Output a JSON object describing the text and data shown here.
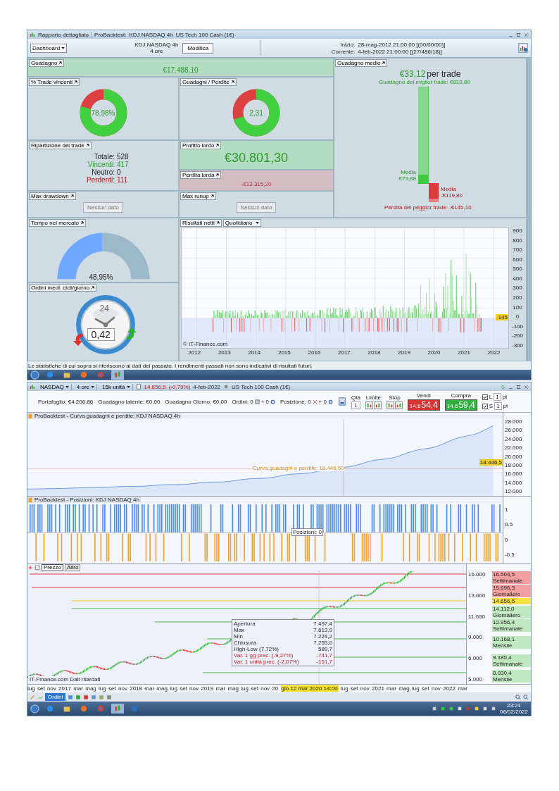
{
  "report_window": {
    "title_bar": {
      "title": "Rapporto dettagliato",
      "tab": "ProBacktest:",
      "system": "KDJ NASDAQ 4h",
      "instrument": "US Tech 100 Cash (1€)"
    },
    "toolbar": {
      "view": "Dashboard",
      "system": "KDJ NASDAQ 4h",
      "timeframe": "4 ore",
      "edit_button": "Modifica",
      "start_label": "Inizio:",
      "start": "28-mag-2012 21:00:00 [(00/00/00)]",
      "current_label": "Corrente:",
      "current": "4-feb-2022 21:00:00 [(27/486/18)]"
    },
    "gain": {
      "title": "Guadagno",
      "value": "€17.488,10"
    },
    "avg_gain": {
      "title": "Guadagno medio",
      "value": "€33,12",
      "unit": "per trade",
      "best_label": "Guadagno del miglior trade: €810,80",
      "win_avg_label": "Media",
      "win_avg": "€73,88",
      "loss_avg_label": "Media",
      "loss_avg": "-€119,80",
      "worst_label": "Perdita del peggior trade: -€145,10"
    },
    "win_rate": {
      "title": "% Trade vincenti",
      "value": "78,98%",
      "level": 0.7898
    },
    "gain_loss": {
      "title": "Guadagni / Perdite",
      "value": "2,31",
      "level": 0.698
    },
    "breakdown": {
      "title": "Ripartizione dei trade",
      "rows": [
        {
          "label": "Totale:",
          "value": "528",
          "kind": "total"
        },
        {
          "label": "Vincenti:",
          "value": "417",
          "kind": "win"
        },
        {
          "label": "Neutro:",
          "value": "0",
          "kind": "neutral"
        },
        {
          "label": "Perdenti:",
          "value": "111",
          "kind": "loss"
        }
      ]
    },
    "gross_profit": {
      "title": "Profitto lordo",
      "value": "€30.801,30"
    },
    "gross_loss": {
      "title": "Perdita lorda",
      "value": "-€13.315,20"
    },
    "max_drawdown": {
      "title": "Max drawdown",
      "empty": "Nessun dato"
    },
    "max_runup": {
      "title": "Max runup",
      "empty": "Nessun dato"
    },
    "time_in_market": {
      "title": "Tempo nel mercato",
      "value": "48,95%"
    },
    "orders_per_day": {
      "title": "Ordini medi. cicli/giorno",
      "hours": "24",
      "value": "0,42"
    },
    "results": {
      "title": "Risultati netti",
      "period": "Quotidiano",
      "credit": "© IT-Finance.com",
      "marker": "-145",
      "yticks": [
        "900",
        "800",
        "700",
        "600",
        "500",
        "400",
        "300",
        "200",
        "100",
        "0",
        "-100",
        "-200",
        "-300"
      ],
      "xlabels": [
        "2012",
        "2013",
        "2014",
        "2015",
        "2016",
        "2017",
        "2018",
        "2019",
        "2020",
        "2021",
        "2022"
      ]
    },
    "disclaimer": "Le statistiche di cui sopra si riferiscono ai dati del passato. I rendimenti passati non sono indicativi di risultati futuri."
  },
  "chart_window": {
    "title_bar": {
      "symbol": "NASDAQ",
      "timeframe": "4 ore",
      "units": "15k unità",
      "price": "14.656,5",
      "change": "(-0,79%)",
      "date": "4-feb-2022",
      "instrument": "US Tech 100 Cash (1€)"
    },
    "trade_bar": {
      "portfolio": "Portafoglio: €4.206,86",
      "latent": "Guadagno latente: €0,00",
      "day": "Guadagno Giorno: €0,00",
      "orders": "Ordini: 0",
      "orders_plus": "+ 0",
      "position": "Posizione: 0",
      "position_plus": "+ 0",
      "qty_label": "Qtà",
      "qty": "1",
      "limit": "Limite",
      "stop": "Stop",
      "sell": {
        "label": "Vendi",
        "prefix": "14.6",
        "price": "54,4"
      },
      "buy": {
        "label": "Compra",
        "prefix": "14.6",
        "price": "59,4"
      },
      "side_rows": [
        {
          "checked": true,
          "label": "L",
          "value": "1",
          "unit": "pt"
        },
        {
          "checked": true,
          "label": "S",
          "value": "1",
          "unit": "pt"
        }
      ]
    },
    "equity_panel": {
      "title": "ProBacktest - Curva guadagni e perdite: KDJ NASDAQ 4h",
      "annotation": "Curva guadagni e perdite: 18.446,50",
      "marker": "18.446,5",
      "yticks": [
        "28.000",
        "26.000",
        "24.000",
        "22.000",
        "20.000",
        "18.000",
        "16.000",
        "14.000",
        "12.000"
      ]
    },
    "positions_panel": {
      "title": "ProBacktest - Posizioni: KDJ NASDAQ 4h",
      "tooltip": "Posizioni: 0",
      "yticks": [
        "1",
        "0.5",
        "0",
        "-0.5"
      ]
    },
    "price_panel": {
      "tabs": [
        {
          "label": "Prezzo",
          "selected": true
        },
        {
          "label": "Altro",
          "selected": false
        }
      ],
      "yticks": [
        "16.000",
        "13.000",
        "11.000",
        "9.000",
        "6.000",
        "5.000"
      ],
      "levels": [
        {
          "value": "16.504,5",
          "label": "Settimanale",
          "kind": "resistance"
        },
        {
          "value": "15.696,3",
          "label": "Giornaliero",
          "kind": "resistance"
        },
        {
          "value": "14.656,5",
          "kind": "current"
        },
        {
          "value": "14.112,0",
          "label": "Giornaliero",
          "kind": "support"
        },
        {
          "value": "12.956,4",
          "label": "Settimanale",
          "kind": "support"
        },
        {
          "value": "10.168,1",
          "label": "Mensile",
          "kind": "support"
        },
        {
          "value": "9.180,4",
          "label": "Settimanale",
          "kind": "support"
        },
        {
          "value": "8.030,4",
          "label": "Mensile",
          "kind": "support"
        }
      ],
      "tooltip": [
        {
          "label": "Apertura",
          "value": "7.497,4",
          "kind": "plain"
        },
        {
          "label": "Max",
          "value": "7.613,9",
          "kind": "plain"
        },
        {
          "label": "Min",
          "value": "7.224,2",
          "kind": "plain"
        },
        {
          "label": "Chiusura",
          "value": "7.255,0",
          "kind": "plain"
        },
        {
          "label": "High-Low (7,72%)",
          "value": "589,7",
          "kind": "plain"
        },
        {
          "label": "Var. 1 gg prec. (-9,27%)",
          "value": "-741,7",
          "kind": "down"
        },
        {
          "label": "Var. 1 unità prec. (-2,07%)",
          "value": "-151,7",
          "kind": "down"
        }
      ],
      "credit": "IT-Finance.com Dati ritardati",
      "xlabels": [
        "lug",
        "set",
        "nov",
        "2017",
        "mar",
        "mag",
        "lug",
        "set",
        "nov",
        "2018",
        "mar",
        "mag",
        "lug",
        "set",
        "nov",
        "2019",
        "mar",
        "mag",
        "lug",
        "set",
        "nov",
        "20",
        "lug",
        "set",
        "nov",
        "2021",
        "mar",
        "mag",
        "lug",
        "set",
        "nov",
        "2022",
        "mar"
      ],
      "cursor_label": "gio 12 mar 2020 14:00"
    },
    "toolbar": {
      "orders_button": "Ordini"
    },
    "taskbar": {
      "time": "23:21",
      "date": "06/02/2022"
    }
  }
}
